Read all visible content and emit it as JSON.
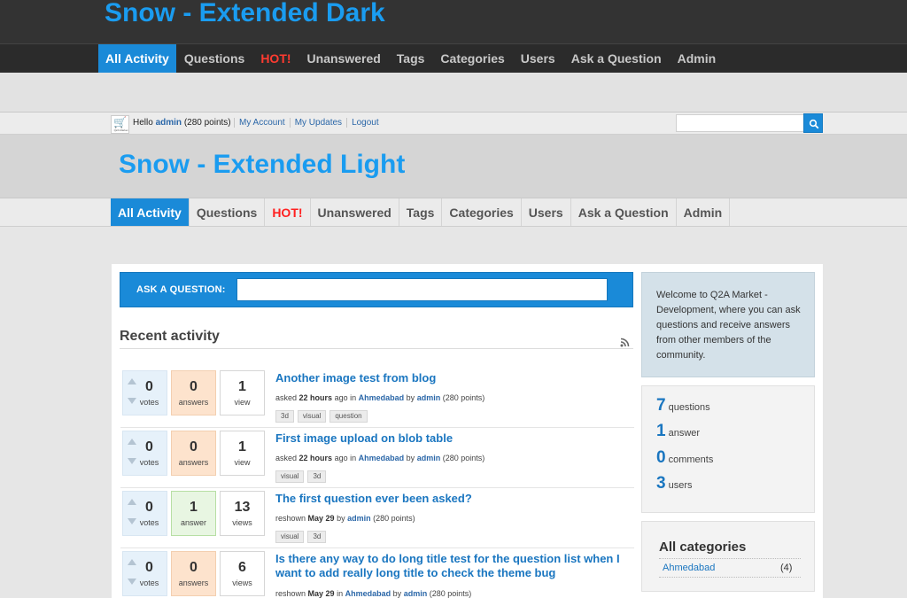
{
  "dark_theme": {
    "title": "Snow - Extended Dark",
    "nav": [
      {
        "label": "All Activity",
        "state": "active"
      },
      {
        "label": "Questions",
        "state": ""
      },
      {
        "label": "HOT!",
        "state": "hot"
      },
      {
        "label": "Unanswered",
        "state": ""
      },
      {
        "label": "Tags",
        "state": ""
      },
      {
        "label": "Categories",
        "state": ""
      },
      {
        "label": "Users",
        "state": ""
      },
      {
        "label": "Ask a Question",
        "state": ""
      },
      {
        "label": "Admin",
        "state": ""
      }
    ]
  },
  "topbar": {
    "hello_prefix": "Hello",
    "username": "admin",
    "points": "(280 points)",
    "links": [
      "My Account",
      "My Updates",
      "Logout"
    ],
    "search_value": "",
    "logo_text": "Q2A Market"
  },
  "light_theme": {
    "title": "Snow - Extended Light",
    "nav": [
      {
        "label": "All Activity",
        "state": "active"
      },
      {
        "label": "Questions",
        "state": ""
      },
      {
        "label": "HOT!",
        "state": "hot"
      },
      {
        "label": "Unanswered",
        "state": ""
      },
      {
        "label": "Tags",
        "state": ""
      },
      {
        "label": "Categories",
        "state": ""
      },
      {
        "label": "Users",
        "state": ""
      },
      {
        "label": "Ask a Question",
        "state": ""
      },
      {
        "label": "Admin",
        "state": ""
      }
    ]
  },
  "ask": {
    "label": "ASK A QUESTION:",
    "value": ""
  },
  "recent": {
    "heading": "Recent activity",
    "items": [
      {
        "votes": "0",
        "votes_label": "votes",
        "answers": "0",
        "answers_label": "answers",
        "answered": false,
        "views": "1",
        "views_label": "view",
        "title": "Another image test from blog",
        "action": "asked",
        "when": "22 hours",
        "ago": "ago in",
        "category": "Ahmedabad",
        "by": "by",
        "user": "admin",
        "user_points": "(280 points)",
        "tags": [
          "3d",
          "visual",
          "question"
        ]
      },
      {
        "votes": "0",
        "votes_label": "votes",
        "answers": "0",
        "answers_label": "answers",
        "answered": false,
        "views": "1",
        "views_label": "view",
        "title": "First image upload on blob table",
        "action": "asked",
        "when": "22 hours",
        "ago": "ago in",
        "category": "Ahmedabad",
        "by": "by",
        "user": "admin",
        "user_points": "(280 points)",
        "tags": [
          "visual",
          "3d"
        ]
      },
      {
        "votes": "0",
        "votes_label": "votes",
        "answers": "1",
        "answers_label": "answer",
        "answered": true,
        "views": "13",
        "views_label": "views",
        "title": "The first question ever been asked?",
        "action": "reshown",
        "when": "May 29",
        "ago": "",
        "category": "",
        "by": "by",
        "user": "admin",
        "user_points": "(280 points)",
        "tags": [
          "visual",
          "3d"
        ]
      },
      {
        "votes": "0",
        "votes_label": "votes",
        "answers": "0",
        "answers_label": "answers",
        "answered": false,
        "views": "6",
        "views_label": "views",
        "title": "Is there any way to do long title test for the question list when I want to add really long title to check the theme bug",
        "action": "reshown",
        "when": "May 29",
        "ago": "in",
        "category": "Ahmedabad",
        "by": "by",
        "user": "admin",
        "user_points": "(280 points)",
        "tags": []
      }
    ]
  },
  "sidebar": {
    "welcome": "Welcome to Q2A Market - Development, where you can ask questions and receive answers from other members of the community.",
    "stats": [
      {
        "n": "7",
        "label": "questions"
      },
      {
        "n": "1",
        "label": "answer"
      },
      {
        "n": "0",
        "label": "comments"
      },
      {
        "n": "3",
        "label": "users"
      }
    ],
    "categories_title": "All categories",
    "categories": [
      {
        "name": "Ahmedabad",
        "count": "(4)"
      }
    ]
  },
  "colors": {
    "accent": "#1a8ad8",
    "title_blue": "#1a9cf0",
    "hot": "#ff2020"
  }
}
